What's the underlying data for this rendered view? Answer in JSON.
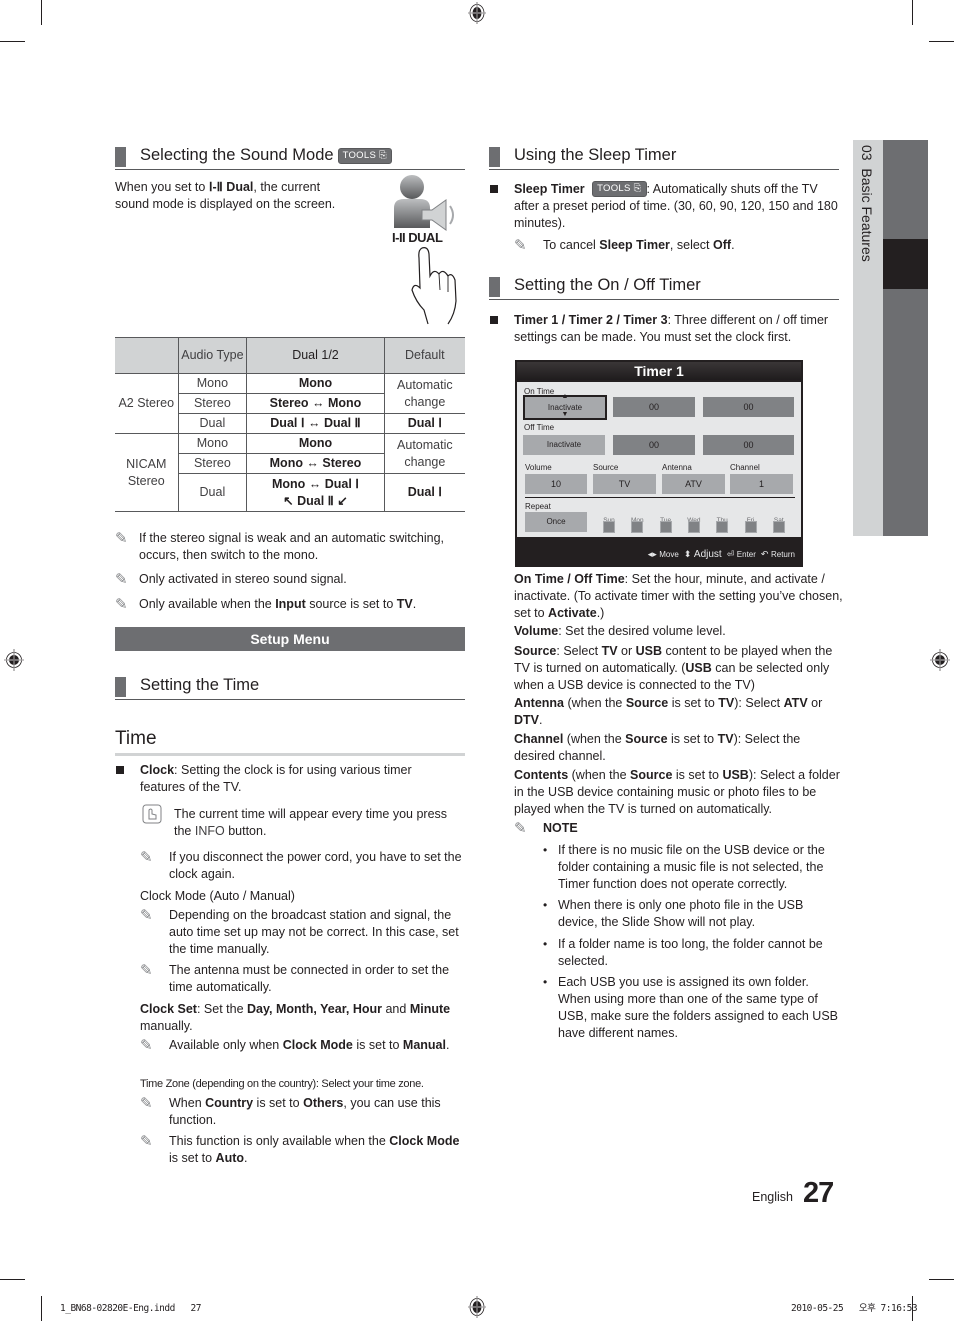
{
  "side_tab": {
    "chapter": "03",
    "title": "Basic Features"
  },
  "left": {
    "sound_mode": {
      "heading": "Selecting the Sound Mode",
      "tools_badge": "TOOLS",
      "intro_pre": "When you set to ",
      "intro_bold": "Ⅰ-Ⅱ Dual",
      "intro_post": ", the current sound mode is displayed on the screen.",
      "illustration_label": "I-II DUAL",
      "table": {
        "headers": [
          "",
          "Audio Type",
          "Dual 1/2",
          "Default"
        ],
        "groups": [
          {
            "name": "A2 Stereo",
            "rows": [
              {
                "audio_type": "Mono",
                "dual": "Mono"
              },
              {
                "audio_type": "Stereo",
                "dual": "Stereo ↔ Mono"
              },
              {
                "audio_type": "Dual",
                "dual": "Dual Ⅰ ↔ Dual Ⅱ"
              }
            ],
            "default_auto": "Automatic change",
            "default_dual": "Dual Ⅰ"
          },
          {
            "name": "NICAM Stereo",
            "rows": [
              {
                "audio_type": "Mono",
                "dual": "Mono"
              },
              {
                "audio_type": "Stereo",
                "dual": "Mono ↔ Stereo"
              },
              {
                "audio_type": "Dual",
                "dual_line1": "Mono ↔ Dual Ⅰ",
                "dual_line2": "↖ Dual Ⅱ ↙"
              }
            ],
            "default_auto": "Automatic change",
            "default_dual": "Dual Ⅰ"
          }
        ]
      },
      "notes": [
        {
          "text": "If the stereo signal is weak and an automatic switching, occurs, then switch to the mono."
        },
        {
          "text": "Only activated in stereo sound signal."
        },
        {
          "pre": "Only available when the ",
          "b1": "Input",
          "mid": " source is set to ",
          "b2": "TV",
          "post": "."
        }
      ]
    },
    "setup_menu_label": "Setup Menu",
    "setting_time_heading": "Setting the Time",
    "time_heading": "Time",
    "clock": {
      "label": "Clock",
      "text": ": Setting the clock is for using various timer features of the TV.",
      "info_pre": "The current time will appear every time you press the ",
      "info_bold": "INFO",
      "info_post": " button.",
      "note_power": "If you disconnect the power cord, you have to set the clock again.",
      "mode_heading": "Clock Mode (Auto / Manual)",
      "mode_note1": "Depending on the broadcast station and signal, the auto time set up may not be correct. In this case, set the time manually.",
      "mode_note2": "The antenna must be connected in order to set the time automatically.",
      "set_label": "Clock Set",
      "set_pre": ": Set the ",
      "set_bold": "Day, Month, Year, Hour",
      "set_and": " and ",
      "set_bold2": "Minute",
      "set_post": " manually.",
      "set_note_pre": "Available only when ",
      "set_note_b1": "Clock Mode",
      "set_note_mid": " is set to ",
      "set_note_b2": "Manual",
      "set_note_post": ".",
      "tz_label": "Time Zone",
      "tz_text": " (depending on the country): Select your time zone.",
      "tz_note1_pre": "When ",
      "tz_note1_b1": "Country",
      "tz_note1_mid": " is set to ",
      "tz_note1_b2": "Others",
      "tz_note1_post": ", you can use this function.",
      "tz_note2_pre": "This function is only available when the ",
      "tz_note2_b1": "Clock Mode",
      "tz_note2_mid": " is set to ",
      "tz_note2_b2": "Auto",
      "tz_note2_post": "."
    }
  },
  "right": {
    "sleep": {
      "heading": "Using the Sleep Timer",
      "label": "Sleep Timer",
      "tools_badge": "TOOLS",
      "text": ": Automatically shuts off the TV after a preset period of time. (30, 60, 90, 120, 150 and 180 minutes).",
      "note_pre": "To cancel ",
      "note_b1": "Sleep Timer",
      "note_mid": ", select ",
      "note_b2": "Off",
      "note_post": "."
    },
    "onoff": {
      "heading": "Setting the On / Off Timer",
      "label": "Timer 1 / Timer 2 / Timer 3",
      "text": ": Three different on / off timer settings can be made. You must set the clock first."
    },
    "timer_screen": {
      "title": "Timer 1",
      "on_time_label": "On Time",
      "on_time": [
        "Inactivate",
        "00",
        "00"
      ],
      "off_time_label": "Off Time",
      "off_time": [
        "Inactivate",
        "00",
        "00"
      ],
      "volume_label": "Volume",
      "volume": "10",
      "source_label": "Source",
      "source": "TV",
      "antenna_label": "Antenna",
      "antenna": "ATV",
      "channel_label": "Channel",
      "channel": "1",
      "repeat_label": "Repeat",
      "repeat": "Once",
      "days": [
        "Sun",
        "Mon",
        "Tue",
        "Wed",
        "Thu",
        "Fri",
        "Sat"
      ],
      "footer": {
        "move": "Move",
        "adjust": "Adjust",
        "enter": "Enter",
        "return": "Return"
      }
    },
    "desc": {
      "ontime_b": "On Time / Off Time",
      "ontime_t": ": Set the hour, minute, and activate / inactivate. (To activate timer with the setting you’ve chosen, set to ",
      "ontime_b2": "Activate",
      "ontime_t2": ".)",
      "volume_b": "Volume",
      "volume_t": ": Set the desired volume level.",
      "source_b": "Source",
      "source_t1": ": Select ",
      "source_b2": "TV",
      "source_t2": " or ",
      "source_b3": "USB",
      "source_t3": " content to be played when the TV is turned on automatically. (",
      "source_b4": "USB",
      "source_t4": " can be selected only when a USB device is connected to the TV)",
      "antenna_b": "Antenna",
      "antenna_t1": " (when the ",
      "antenna_b2": "Source",
      "antenna_t2": " is set to ",
      "antenna_b3": "TV",
      "antenna_t3": "): Select ",
      "antenna_b4": "ATV",
      "antenna_t4": " or ",
      "antenna_b5": "DTV",
      "antenna_t5": ".",
      "channel_b": "Channel",
      "channel_t1": " (when the ",
      "channel_b2": "Source",
      "channel_t2": " is set to ",
      "channel_b3": "TV",
      "channel_t3": "): Select the desired channel.",
      "contents_b": "Contents",
      "contents_t1": " (when the ",
      "contents_b2": "Source",
      "contents_t2": " is set to ",
      "contents_b3": "USB",
      "contents_t3": "): Select a folder in the USB device containing music or photo files to be played when the TV is turned on automatically.",
      "note_label": "NOTE",
      "bullets": [
        "If there is no music file on the USB device or the folder containing a music file is not selected, the Timer function does not operate correctly.",
        "When there is only one photo file in the USB device, the Slide Show will not play.",
        "If a folder name is too long, the folder cannot be selected.",
        "Each USB you use is assigned its own folder. When using more than one of the same type of USB, make sure the folders assigned to each USB have different names."
      ]
    }
  },
  "footer": {
    "language": "English",
    "page_number": "27",
    "slug_file": "1_BN68-02820E-Eng.indd   27",
    "slug_date": "2010-05-25   오후 7:16:53"
  }
}
